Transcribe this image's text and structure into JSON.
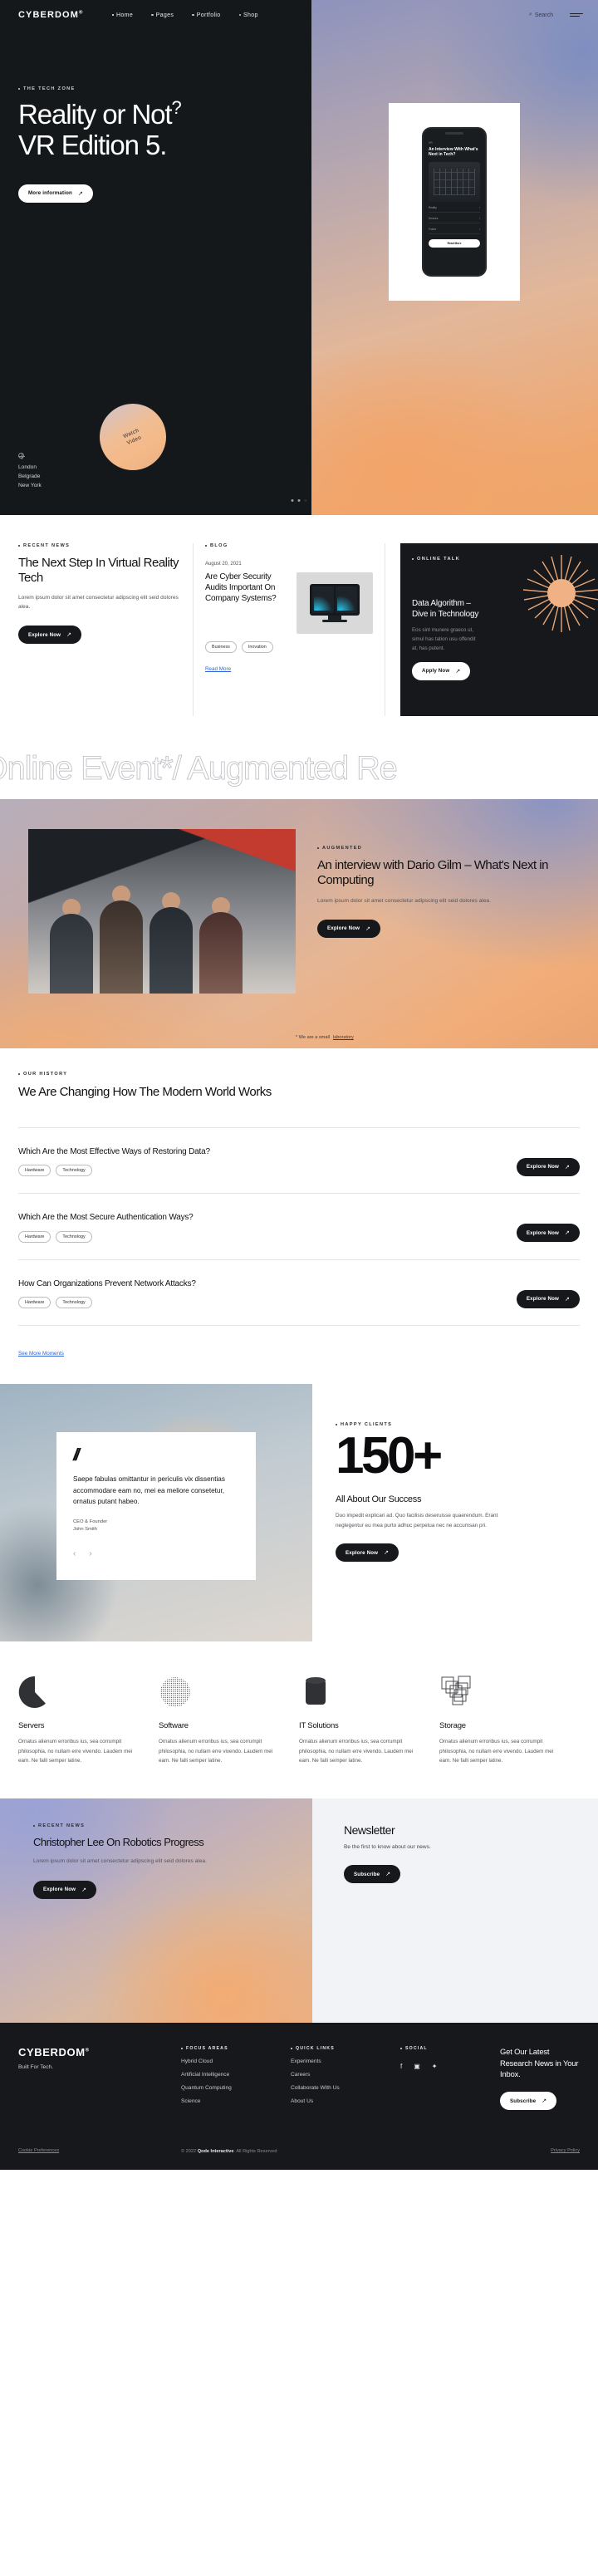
{
  "header": {
    "brand": "CYBERDOM",
    "brand_sup": "®",
    "nav": [
      {
        "label": "Home",
        "active": true
      },
      {
        "label": "Pages",
        "active": false
      },
      {
        "label": "Portfolio",
        "active": false
      },
      {
        "label": "Shop",
        "active": false
      }
    ],
    "search_label": "Search",
    "search_icon": "search-icon",
    "menu_icon": "hamburger-icon"
  },
  "hero": {
    "eyebrow": "THE TECH ZONE",
    "title_line1": "Reality or Not",
    "title_sup": "?",
    "title_line2": "VR Edition 5.",
    "cta": "More information",
    "arrow": "↗",
    "locations": [
      "London",
      "Belgrade",
      "New York"
    ],
    "badge_line1": "Watch",
    "badge_line2": "Video",
    "phone": {
      "eyebrow": "VR",
      "title": "An Interview With What's Next in Tech?",
      "row1": "Reality",
      "row2": "Devices",
      "row3": "Future",
      "button": "Read More"
    },
    "slider_dots": 3,
    "active_dot": 3
  },
  "news": {
    "left": {
      "eyebrow": "RECENT NEWS",
      "title": "The Next Step In Virtual Reality Tech",
      "body": "Lorem ipsum dolor sit amet consectetur adipscing elit seid dolores alea.",
      "cta": "Explore Now"
    },
    "mid": {
      "eyebrow": "BLOG",
      "date": "August 20, 2021",
      "title": "Are Cyber Security Audits Important On Company Systems?",
      "tags": [
        "Business",
        "Inovation"
      ],
      "readmore": "Read More"
    },
    "right": {
      "eyebrow": "ONLINE TALK",
      "title": "Data Algorithm – Dive in Technology",
      "body": "Eos sint munere graeco ut, simul has tation usu offendit at, has putent.",
      "cta": "Apply Now"
    }
  },
  "marquee": {
    "text": "al Online Event*/ Augmented Re"
  },
  "interview": {
    "eyebrow": "AUGMENTED",
    "title": "An interview with Dario Gilm – What's Next in Computing",
    "body": "Lorem ipsum dolor sit amet consectetur adipscing elit seid dolores alea.",
    "cta": "Explore Now",
    "note_prefix": "* We are a small",
    "note_link": "laboratory"
  },
  "history": {
    "eyebrow": "OUR HISTORY",
    "title": "We Are Changing How The Modern World Works",
    "items": [
      {
        "title": "Which Are the Most Effective Ways of Restoring Data?",
        "tags": [
          "Hardware",
          "Technology"
        ],
        "cta": "Explore Now"
      },
      {
        "title": "Which Are the Most Secure Authentication Ways?",
        "tags": [
          "Hardware",
          "Technology"
        ],
        "cta": "Explore Now"
      },
      {
        "title": "How Can Organizations Prevent Network Attacks?",
        "tags": [
          "Hardware",
          "Technology"
        ],
        "cta": "Explore Now"
      }
    ],
    "see_more": "See More Moments"
  },
  "testimonial": {
    "quote_mark": "//",
    "quote": "Saepe fabulas omittantur in periculis vix dissentias accommodare eam no, mei ea meliore consetetur, ornatus putant habeo.",
    "role": "CEO & Founder",
    "name": "John Smith",
    "prev_icon": "chevron-left-icon",
    "next_icon": "chevron-right-icon",
    "stats": {
      "eyebrow": "HAPPY CLIENTS",
      "number": "150+",
      "title": "All About Our Success",
      "body": "Duo impedit explicari ad. Quo facilisis deseruisse quaerendum. Erant neglegentur eu mea purto adhuc perpetua nec ne accumsan pri.",
      "cta": "Explore Now"
    }
  },
  "services": [
    {
      "icon": "pacman-shape-icon",
      "title": "Servers",
      "body": "Ornatus alienum erroribus ius, sea corrumpit philosophia, no nullam erre vivendo. Laudem mei eam. Ne falli semper latine."
    },
    {
      "icon": "dotted-sphere-icon",
      "title": "Software",
      "body": "Ornatus alienum erroribus ius, sea corrumpit philosophia, no nullam erre vivendo. Laudem mei eam. Ne falli semper latine."
    },
    {
      "icon": "cylinder-icon",
      "title": "IT Solutions",
      "body": "Ornatus alienum erroribus ius, sea corrumpit philosophia, no nullam erre vivendo. Laudem mei eam. Ne falli semper latine."
    },
    {
      "icon": "stacked-squares-icon",
      "title": "Storage",
      "body": "Ornatus alienum erroribus ius, sea corrumpit philosophia, no nullam erre vivendo. Laudem mei eam. Ne falli semper latine."
    }
  ],
  "recent": {
    "eyebrow": "RECENT NEWS",
    "title": "Christopher Lee On Robotics Progress",
    "body": "Lorem ipsum dolor sit amet consectetur adipscing elit seid dolores alea.",
    "cta": "Explore Now"
  },
  "newsletter": {
    "title": "Newsletter",
    "body": "Be the first to know about our news.",
    "cta": "Subscribe"
  },
  "footer": {
    "brand": "CYBERDOM",
    "brand_sup": "®",
    "tagline": "Built For Tech.",
    "col1": {
      "head": "FOCUS AREAS",
      "links": [
        "Hybrid Cloud",
        "Artificial Intelligence",
        "Quantum Computing",
        "Science"
      ]
    },
    "col2": {
      "head": "QUICK LINKS",
      "links": [
        "Experiments",
        "Careers",
        "Collaborate With Us",
        "About Us"
      ]
    },
    "social": {
      "head": "SOCIAL",
      "icons": [
        "facebook-icon",
        "instagram-icon",
        "twitter-icon"
      ],
      "glyphs": [
        "f",
        "◎",
        "🐦"
      ]
    },
    "cta": {
      "title": "Get Our Latest Research News in Your Inbox.",
      "button": "Subscribe"
    },
    "bottom": {
      "cookie": "Cookie Preferences",
      "copyright_pre": "© 2022 ",
      "copyright_brand": "Qode Interactive",
      "copyright_post": ". All Rights Reserved",
      "privacy": "Privacy Policy",
      "terms": "Cookie Preferences"
    }
  },
  "colors": {
    "dark": "#16181b",
    "accent_orange": "#efa668",
    "accent_blue": "#8a93c2",
    "link": "#2f63d8"
  }
}
